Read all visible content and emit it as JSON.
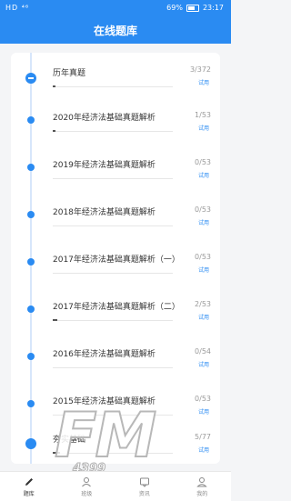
{
  "statusbar": {
    "left": "HD ⁴⁶",
    "battery_pct": "69%",
    "time": "23:17"
  },
  "header": {
    "title": "在线题库"
  },
  "items": [
    {
      "title": "历年真题",
      "count": "3/372",
      "tag": "试用",
      "progress": 0.01
    },
    {
      "title": "2020年经济法基础真题解析",
      "count": "1/53",
      "tag": "试用",
      "progress": 0.02
    },
    {
      "title": "2019年经济法基础真题解析",
      "count": "0/53",
      "tag": "试用",
      "progress": 0
    },
    {
      "title": "2018年经济法基础真题解析",
      "count": "0/53",
      "tag": "试用",
      "progress": 0
    },
    {
      "title": "2017年经济法基础真题解析（一）",
      "count": "0/53",
      "tag": "试用",
      "progress": 0
    },
    {
      "title": "2017年经济法基础真题解析（二）",
      "count": "2/53",
      "tag": "试用",
      "progress": 0.04
    },
    {
      "title": "2016年经济法基础真题解析",
      "count": "0/54",
      "tag": "试用",
      "progress": 0
    },
    {
      "title": "2015年经济法基础真题解析",
      "count": "0/53",
      "tag": "试用",
      "progress": 0
    },
    {
      "title": "夯实基础",
      "count": "5/77",
      "tag": "试用",
      "progress": 0.06
    }
  ],
  "watermark": {
    "text": "FM",
    "sub": "4399"
  },
  "tabs": [
    {
      "label": "题库",
      "icon": "pencil-icon",
      "active": true
    },
    {
      "label": "班级",
      "icon": "class-icon",
      "active": false
    },
    {
      "label": "资讯",
      "icon": "news-icon",
      "active": false
    },
    {
      "label": "我的",
      "icon": "user-icon",
      "active": false
    }
  ],
  "colors": {
    "accent": "#2a8bf2"
  }
}
